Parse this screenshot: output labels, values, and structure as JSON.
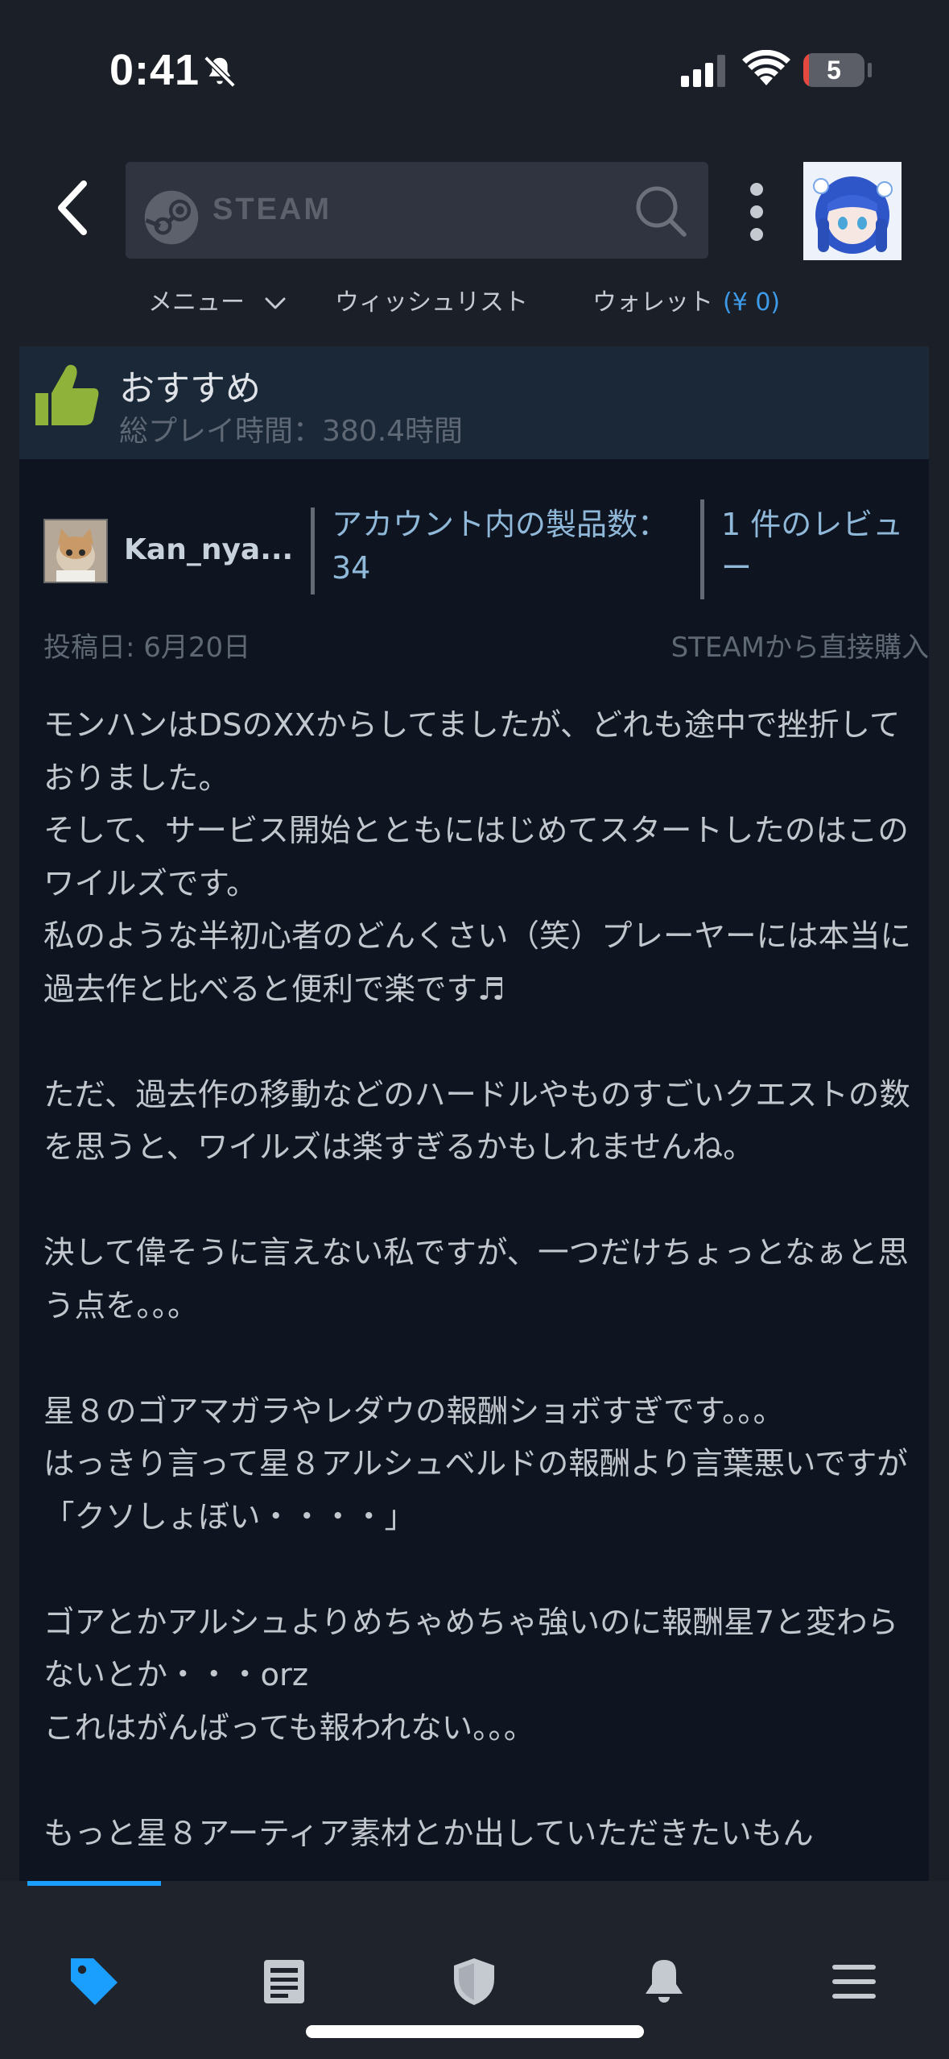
{
  "status_bar": {
    "time": "0:41",
    "battery_level": "5",
    "icons": [
      "bell-slash-icon",
      "cellular-signal-icon",
      "wifi-icon",
      "battery-icon"
    ]
  },
  "header": {
    "search_brand": "STEAM",
    "nav": {
      "menu_label": "メニュー",
      "wishlist_label": "ウィッシュリスト",
      "wallet_label": "ウォレット",
      "wallet_amount": "(¥ 0)"
    }
  },
  "review": {
    "verdict": "おすすめ",
    "playtime": "総プレイ時間：380.4時間",
    "author": {
      "name": "Kan_nya...",
      "products_owned_label": "アカウント内の製品数：34",
      "review_count_label": "1 件のレビュー"
    },
    "posted_date": "投稿日: 6月20日",
    "purchase_source": "STEAMから直接購入",
    "paragraphs": [
      "モンハンはDSのXXからしてましたが、どれも途中で挫折しておりました。\nそして、サービス開始とともにはじめてスタートしたのはこのワイルズです。\n私のような半初心者のどんくさい（笑）プレーヤーには本当に過去作と比べると便利で楽です♬",
      "ただ、過去作の移動などのハードルやものすごいクエストの数を思うと、ワイルズは楽すぎるかもしれませんね。",
      "決して偉そうに言えない私ですが、一つだけちょっとなぁと思う点を。。。",
      "星８のゴアマガラやレダウの報酬ショボすぎです。。。\nはっきり言って星８アルシュベルドの報酬より言葉悪いですが「クソしょぼい・・・・」",
      "ゴアとかアルシュよりめちゃめちゃ強いのに報酬星7と変わらないとか・・・orz\nこれはがんばっても報われない。。。",
      "もっと星８アーティア素材とか出していただきたいもん"
    ]
  },
  "colors": {
    "accent": "#1a9fff",
    "background": "#1b1f27",
    "panel": "#0f1520",
    "recommend_bar": "#1b2838",
    "thumb_green": "#8fb23a"
  },
  "tabbar": {
    "tabs": [
      "store-tag-icon",
      "news-icon",
      "shield-icon",
      "notification-bell-icon",
      "hamburger-menu-icon"
    ],
    "active_index": 0
  }
}
